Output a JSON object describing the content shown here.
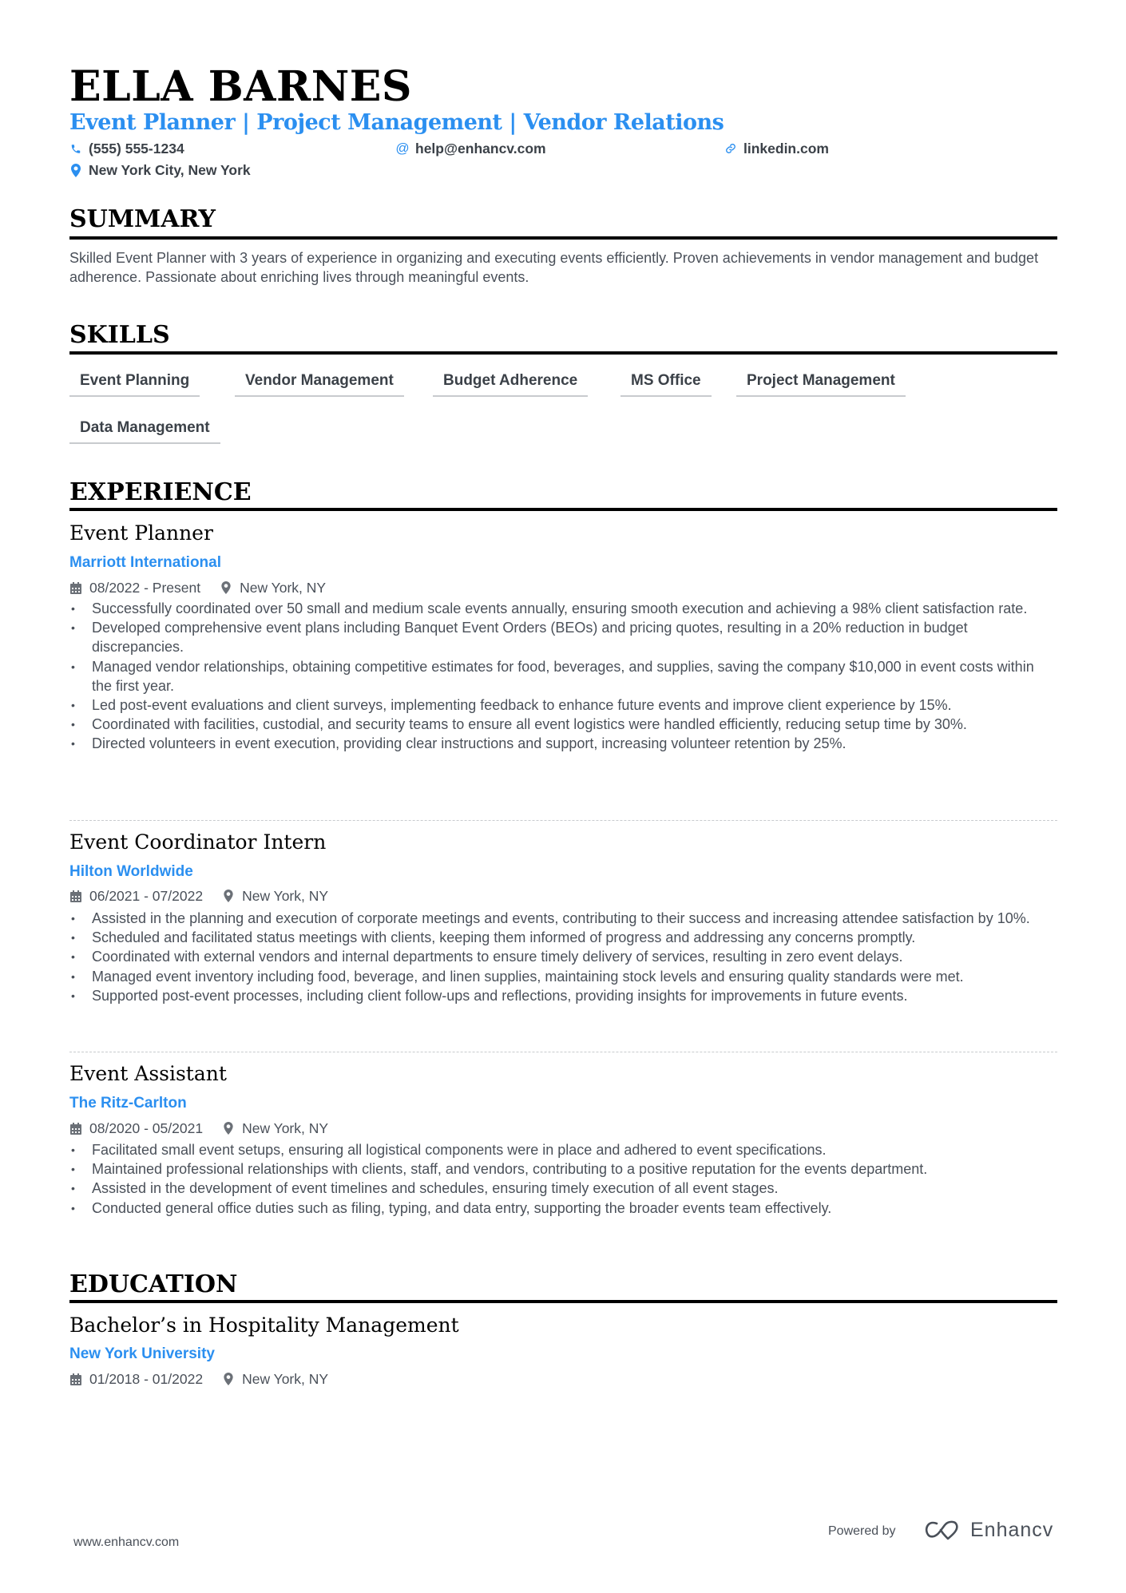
{
  "header": {
    "name": "ELLA BARNES",
    "subtitle": "Event Planner | Project Management | Vendor Relations",
    "contacts": [
      {
        "icon": "phone-icon",
        "text": "(555) 555-1234"
      },
      {
        "icon": "at-icon",
        "text": "help@enhancv.com"
      },
      {
        "icon": "link-icon",
        "text": "linkedin.com"
      },
      {
        "icon": "location-pin-icon",
        "text": "New York City, New York"
      }
    ]
  },
  "summary": {
    "title": "SUMMARY",
    "text": "Skilled Event Planner with 3 years of experience in organizing and executing events efficiently. Proven achievements in vendor management and budget adherence. Passionate about enriching lives through meaningful events."
  },
  "skills": {
    "title": "SKILLS",
    "items": [
      "Event Planning",
      "Vendor Management",
      "Budget Adherence",
      "MS Office",
      "Project Management",
      "Data Management"
    ]
  },
  "experience": {
    "title": "EXPERIENCE",
    "jobs": [
      {
        "title": "Event Planner",
        "company": "Marriott International",
        "dates": "08/2022 - Present",
        "location": "New York, NY",
        "bullets": [
          "Successfully coordinated over 50 small and medium scale events annually, ensuring smooth execution and achieving a 98% client satisfaction rate.",
          "Developed comprehensive event plans including Banquet Event Orders (BEOs) and pricing quotes, resulting in a 20% reduction in budget discrepancies.",
          "Managed vendor relationships, obtaining competitive estimates for food, beverages, and supplies, saving the company $10,000 in event costs within the first year.",
          "Led post-event evaluations and client surveys, implementing feedback to enhance future events and improve client experience by 15%.",
          "Coordinated with facilities, custodial, and security teams to ensure all event logistics were handled efficiently, reducing setup time by 30%.",
          "Directed volunteers in event execution, providing clear instructions and support, increasing volunteer retention by 25%."
        ]
      },
      {
        "title": "Event Coordinator Intern",
        "company": "Hilton Worldwide",
        "dates": "06/2021 - 07/2022",
        "location": "New York, NY",
        "bullets": [
          "Assisted in the planning and execution of corporate meetings and events, contributing to their success and increasing attendee satisfaction by 10%.",
          "Scheduled and facilitated status meetings with clients, keeping them informed of progress and addressing any concerns promptly.",
          "Coordinated with external vendors and internal departments to ensure timely delivery of services, resulting in zero event delays.",
          "Managed event inventory including food, beverage, and linen supplies, maintaining stock levels and ensuring quality standards were met.",
          "Supported post-event processes, including client follow-ups and reflections, providing insights for improvements in future events."
        ]
      },
      {
        "title": "Event Assistant",
        "company": "The Ritz-Carlton",
        "dates": "08/2020 - 05/2021",
        "location": "New York, NY",
        "bullets": [
          "Facilitated small event setups, ensuring all logistical components were in place and adhered to event specifications.",
          "Maintained professional relationships with clients, staff, and vendors, contributing to a positive reputation for the events department.",
          "Assisted in the development of event timelines and schedules, ensuring timely execution of all event stages.",
          "Conducted general office duties such as filing, typing, and data entry, supporting the broader events team effectively."
        ]
      }
    ]
  },
  "education": {
    "title": "EDUCATION",
    "degree": "Bachelor’s in Hospitality Management",
    "school": "New York University",
    "dates": "01/2018 - 01/2022",
    "location": "New York, NY"
  },
  "footer": {
    "url": "www.enhancv.com",
    "powered_by": "Powered by",
    "brand": "Enhancv"
  },
  "colors": {
    "accent": "#2b8ff0",
    "heading": "#000000",
    "text": "#4a5059"
  }
}
